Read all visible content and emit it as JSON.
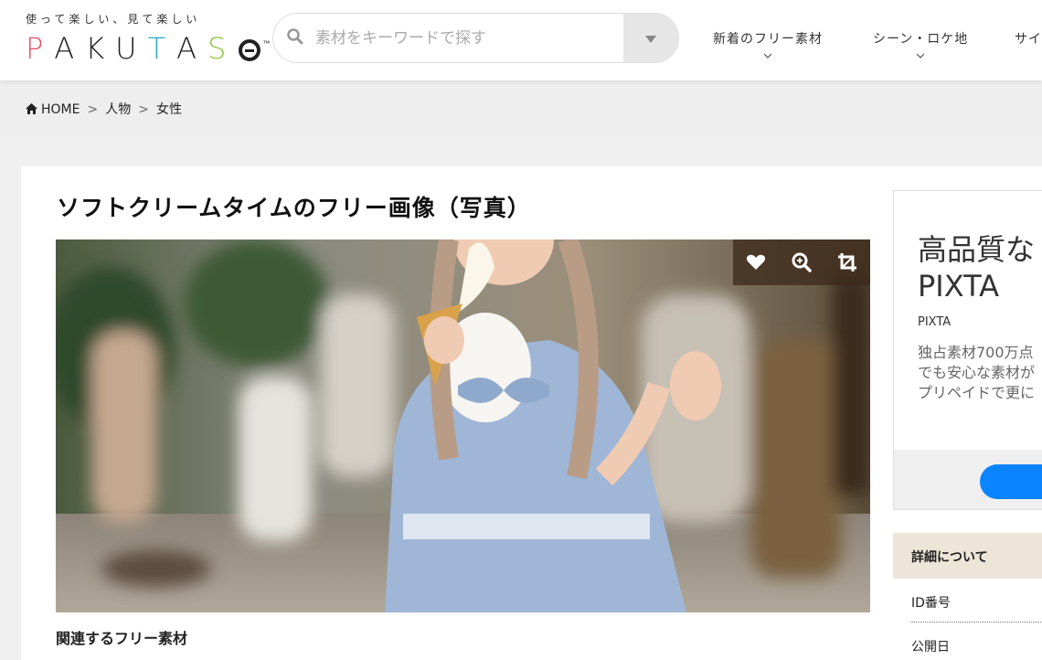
{
  "header": {
    "tagline": "使って楽しい、見て楽しい",
    "logo_letters": [
      "P",
      "A",
      "K",
      "U",
      "T",
      "A",
      "S"
    ],
    "logo_colors": [
      "#e94f6a",
      "#222222",
      "#222222",
      "#222222",
      "#2aa6c8",
      "#222222",
      "#8cc63f"
    ],
    "logo_tm": "™",
    "search": {
      "placeholder": "素材をキーワードで探す",
      "icon": "search-icon",
      "dropdown_icon": "caret-down-icon"
    },
    "nav": [
      {
        "label": "新着のフリー素材",
        "icon": "chevron-down-icon"
      },
      {
        "label": "シーン・ロケ地",
        "icon": "chevron-down-icon"
      },
      {
        "label": "サイ",
        "icon": "chevron-down-icon"
      }
    ]
  },
  "breadcrumb": {
    "items": [
      "HOME",
      "人物",
      "女性"
    ],
    "separator": "＞",
    "home_icon": "home-icon"
  },
  "main": {
    "title": "ソフトクリームタイムのフリー画像（写真）",
    "photo_tools": [
      "heart-icon",
      "zoom-in-icon",
      "crop-icon"
    ],
    "related_heading": "関連するフリー素材"
  },
  "sidebar": {
    "ad": {
      "title_line1": "高品質な",
      "title_line2": "PIXTA",
      "source": "PIXTA",
      "desc_line1": "独占素材700万点",
      "desc_line2": "でも安心な素材が",
      "desc_line3": "プリペイドで更に",
      "button_color": "#0b84ff"
    },
    "details": {
      "heading": "詳細について",
      "rows": [
        "ID番号",
        "公開日"
      ]
    }
  }
}
